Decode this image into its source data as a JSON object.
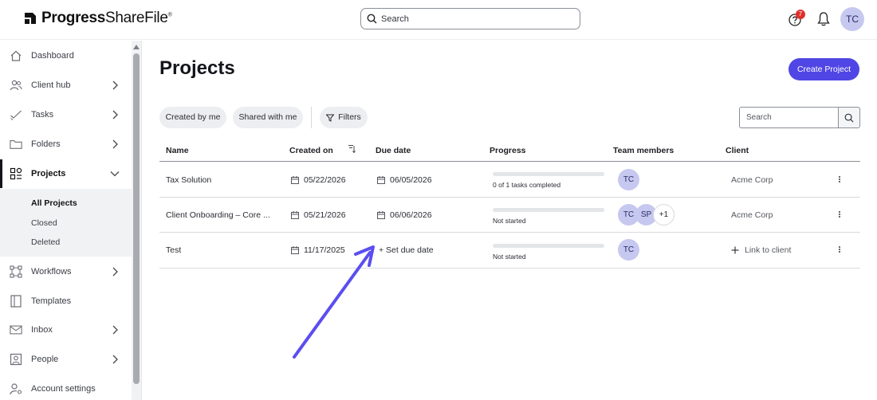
{
  "app": {
    "logo_bold": "Progress",
    "logo_light": "ShareFile",
    "logo_mark": "®"
  },
  "topbar": {
    "search_placeholder": "Search",
    "notification_count": "7",
    "avatar_initials": "TC"
  },
  "sidebar": {
    "items": [
      {
        "label": "Dashboard",
        "icon": "home-icon",
        "chevron": false
      },
      {
        "label": "Client hub",
        "icon": "people-icon",
        "chevron": true
      },
      {
        "label": "Tasks",
        "icon": "check-icon",
        "chevron": true
      },
      {
        "label": "Folders",
        "icon": "folder-icon",
        "chevron": true
      },
      {
        "label": "Projects",
        "icon": "grid-icon",
        "chevron": true,
        "active": true
      },
      {
        "label": "Workflows",
        "icon": "workflow-icon",
        "chevron": true
      },
      {
        "label": "Templates",
        "icon": "template-icon",
        "chevron": false
      },
      {
        "label": "Inbox",
        "icon": "mail-icon",
        "chevron": true
      },
      {
        "label": "People",
        "icon": "person-icon",
        "chevron": true
      },
      {
        "label": "Account settings",
        "icon": "settings-person-icon",
        "chevron": false
      }
    ],
    "projects_sub": [
      {
        "label": "All Projects",
        "active": true
      },
      {
        "label": "Closed"
      },
      {
        "label": "Deleted"
      }
    ]
  },
  "main": {
    "title": "Projects",
    "create_button": "Create Project",
    "filter_chips": [
      "Created by me",
      "Shared with me"
    ],
    "filters_label": "Filters",
    "search_placeholder": "Search",
    "columns": [
      "Name",
      "Created on",
      "Due date",
      "Progress",
      "Team members",
      "Client"
    ],
    "rows": [
      {
        "name": "Tax Solution",
        "created_on": "05/22/2026",
        "due_date": "06/05/2026",
        "progress_fraction": 0,
        "progress_text": "0 of 1 tasks completed",
        "members": [
          "TC"
        ],
        "client": "Acme Corp"
      },
      {
        "name": "Client Onboarding – Core ...",
        "created_on": "05/21/2026",
        "due_date": "06/06/2026",
        "progress_fraction": 0,
        "progress_text": "Not started",
        "members": [
          "TC",
          "SP"
        ],
        "members_more": "+1",
        "client": "Acme Corp"
      },
      {
        "name": "Test",
        "created_on": "11/17/2025",
        "due_date_action": "+ Set due date",
        "progress_fraction": 0,
        "progress_text": "Not started",
        "members": [
          "TC"
        ],
        "client_action": "Link to client"
      }
    ]
  },
  "colors": {
    "accent": "#5046e5",
    "avatar_bg": "#c6c8f0",
    "badge": "#e0302b"
  }
}
